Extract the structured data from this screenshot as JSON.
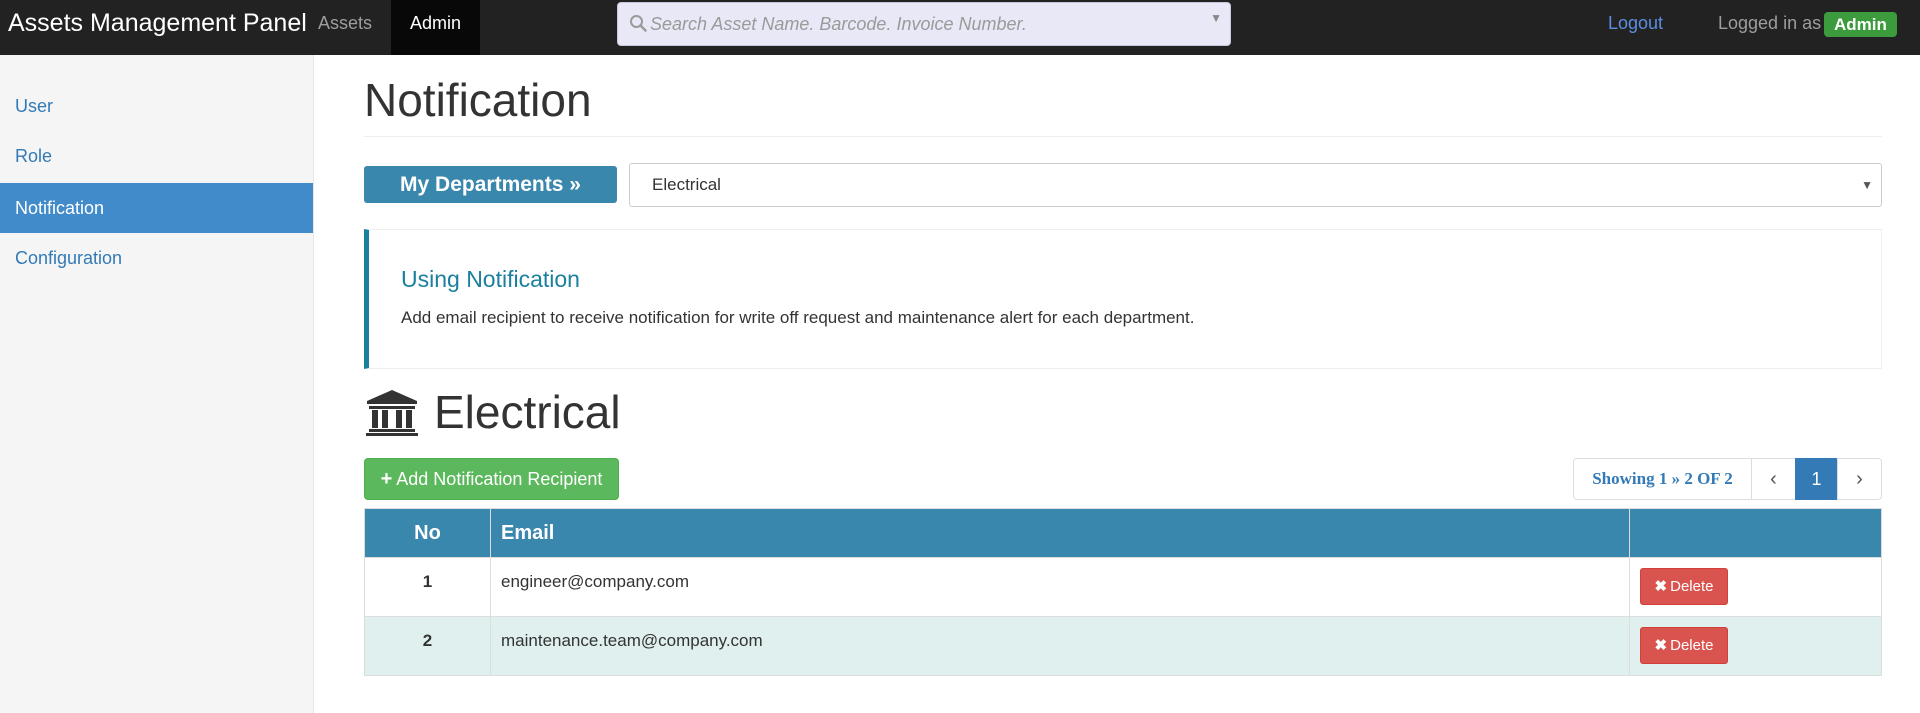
{
  "navbar": {
    "brand": "Assets Management Panel",
    "tabs": [
      {
        "label": "Assets"
      },
      {
        "label": "Admin",
        "active": true
      }
    ],
    "search": {
      "placeholder": "Search Asset Name. Barcode. Invoice Number.",
      "value": ""
    },
    "logout_label": "Logout",
    "logged_in_label": "Logged in as",
    "user": "Admin"
  },
  "sidebar": {
    "items": [
      {
        "label": "User"
      },
      {
        "label": "Role"
      },
      {
        "label": "Notification",
        "active": true
      },
      {
        "label": "Configuration"
      }
    ]
  },
  "main": {
    "page_title": "Notification",
    "department_button": "My Departments »",
    "department_select": {
      "selected": "Electrical"
    },
    "callout": {
      "title": "Using Notification",
      "text": "Add email recipient to receive notification for write off request and maintenance alert for each department."
    },
    "section_title": "Electrical",
    "add_button": "Add Notification Recipient",
    "pagination": {
      "info": "Showing 1 » 2 OF 2",
      "current_page": "1"
    },
    "table": {
      "headers": {
        "no": "No",
        "email": "Email",
        "action": ""
      },
      "rows": [
        {
          "no": "1",
          "email": "engineer@company.com",
          "action": "Delete"
        },
        {
          "no": "2",
          "email": "maintenance.team@company.com",
          "action": "Delete"
        }
      ]
    }
  },
  "colors": {
    "navbar_bg": "#222222",
    "accent_blue": "#3a87ad",
    "sidebar_active": "#428bca",
    "success_green": "#5cb85c",
    "danger_red": "#d9534f",
    "alt_row": "#dff0ef"
  },
  "icons": [
    "search-icon",
    "chevron-down-icon",
    "bank-icon",
    "plus-icon",
    "chevron-left-icon",
    "chevron-right-icon",
    "times-icon"
  ]
}
